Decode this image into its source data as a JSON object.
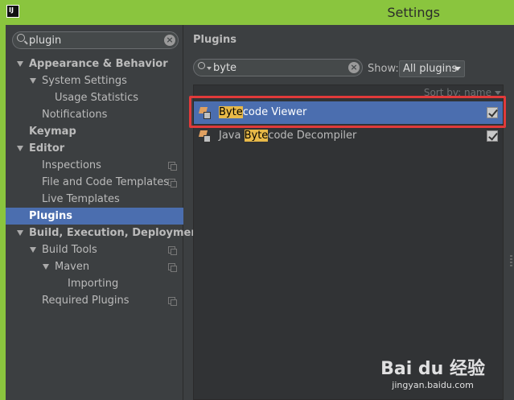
{
  "window": {
    "title": "Settings",
    "logo": "IJ"
  },
  "left": {
    "search_value": "plugin",
    "tree": [
      {
        "label": "Appearance & Behavior",
        "level": 0,
        "bold": true,
        "expanded": true
      },
      {
        "label": "System Settings",
        "level": 1,
        "bold": false,
        "expanded": true
      },
      {
        "label": "Usage Statistics",
        "level": 2,
        "bold": false
      },
      {
        "label": "Notifications",
        "level": 1,
        "bold": false
      },
      {
        "label": "Keymap",
        "level": 0,
        "bold": true
      },
      {
        "label": "Editor",
        "level": 0,
        "bold": true,
        "expanded": true
      },
      {
        "label": "Inspections",
        "level": 1,
        "bold": false,
        "project": true
      },
      {
        "label": "File and Code Templates",
        "level": 1,
        "bold": false,
        "project": true
      },
      {
        "label": "Live Templates",
        "level": 1,
        "bold": false
      },
      {
        "label": "Plugins",
        "level": 0,
        "bold": true,
        "selected": true
      },
      {
        "label": "Build, Execution, Deployment",
        "level": 0,
        "bold": true,
        "expanded": true
      },
      {
        "label": "Build Tools",
        "level": 1,
        "bold": false,
        "expanded": true,
        "project": true
      },
      {
        "label": "Maven",
        "level": 2,
        "bold": false,
        "expanded": true,
        "project": true
      },
      {
        "label": "Importing",
        "level": 3,
        "bold": false
      },
      {
        "label": "Required Plugins",
        "level": 1,
        "bold": false,
        "project": true
      }
    ]
  },
  "right": {
    "title": "Plugins",
    "search_value": "byte",
    "show_label": "Show:",
    "show_value": "All plugins",
    "sort_label": "Sort by: name",
    "plugins": [
      {
        "highlight": "Byte",
        "rest": "code Viewer",
        "prefix": "",
        "checked": true,
        "selected": true
      },
      {
        "highlight": "Byte",
        "rest": "code Decompiler",
        "prefix": "Java ",
        "checked": true,
        "selected": false
      }
    ]
  },
  "watermark": {
    "main": "Bai du 经验",
    "sub": "jingyan.baidu.com"
  },
  "colors": {
    "titlebar": "#8ac53e",
    "panel": "#3c3f41",
    "selection": "#4b6eaf",
    "highlight": "#e8b948",
    "redbox": "#e13a3a"
  }
}
